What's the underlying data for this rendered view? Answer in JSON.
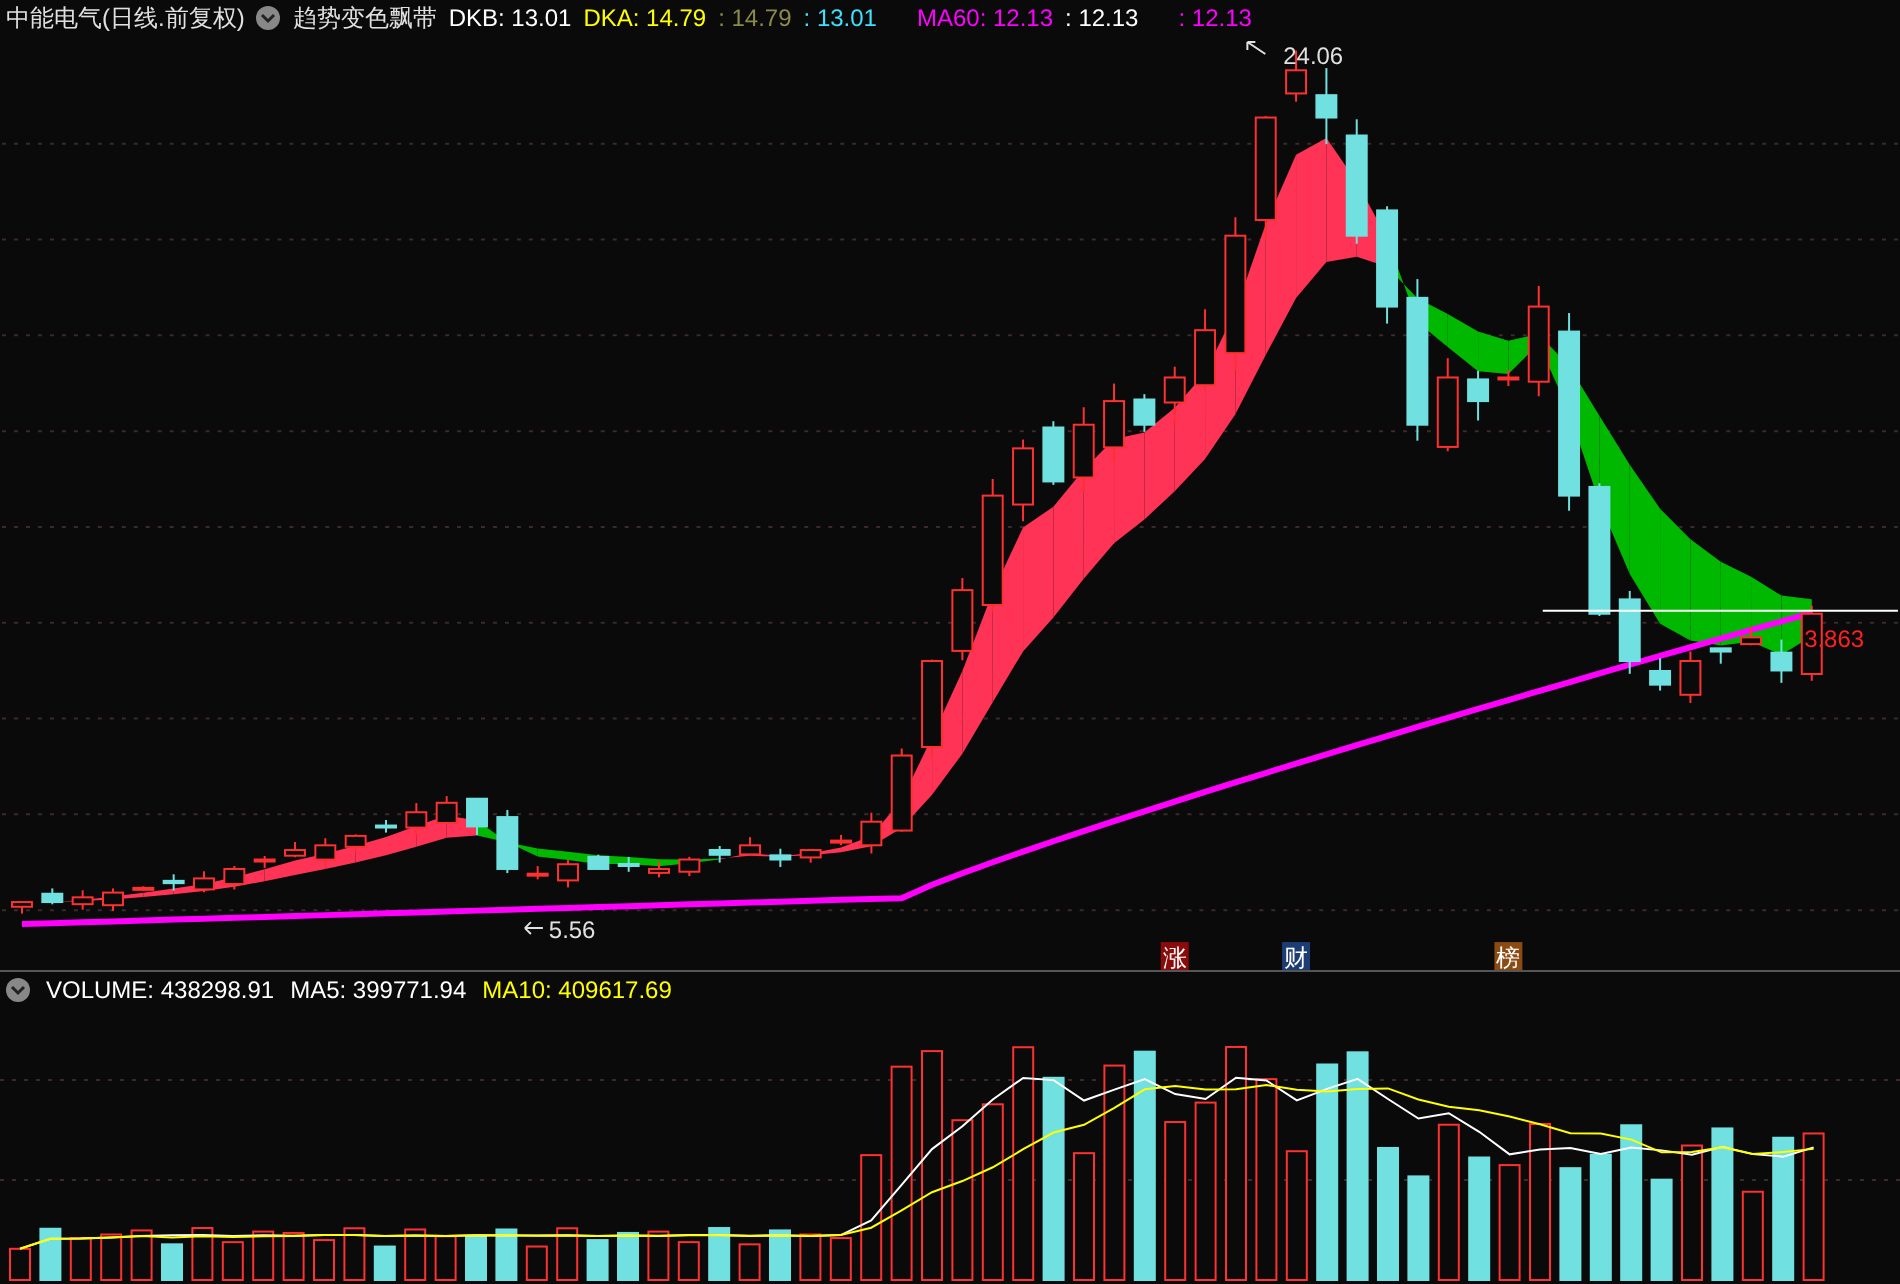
{
  "title": "中能电气(日线.前复权)",
  "indicator": "趋势变色飘带",
  "legend": [
    {
      "text": "DKB: 13.01",
      "color": "#ffffff"
    },
    {
      "text": "DKA: 14.79",
      "color": "#ffff00"
    },
    {
      "text": ": 14.79",
      "color": "#8a8a4a"
    },
    {
      "text": ": 13.01",
      "color": "#40e0ff"
    },
    {
      "text": "MA60: 12.13",
      "color": "#ff00ff"
    },
    {
      "text": ": 12.13",
      "color": "#ffffff"
    },
    {
      "text": ": 12.13",
      "color": "#ff00ff"
    }
  ],
  "price_labels": {
    "high": "24.06",
    "low": "5.56",
    "line_value": "3.863"
  },
  "event_markers": [
    {
      "text": "涨",
      "color": "#8b0a0a"
    },
    {
      "text": "财",
      "color": "#1c3d73"
    },
    {
      "text": "榜",
      "color": "#8a4a12"
    }
  ],
  "volume_legend": [
    {
      "text": "VOLUME: 438298.91",
      "color": "#ffffff"
    },
    {
      "text": "MA5: 399771.94",
      "color": "#ffffff"
    },
    {
      "text": "MA10: 409617.69",
      "color": "#ffff00"
    }
  ]
}
